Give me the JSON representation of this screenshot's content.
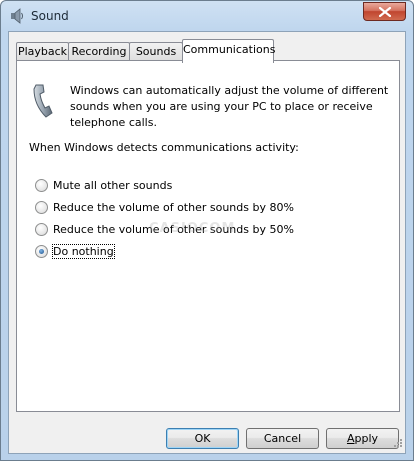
{
  "window": {
    "title": "Sound",
    "title_icon": "speaker-icon",
    "close_icon": "close-x-icon"
  },
  "tabs": [
    {
      "label": "Playback",
      "active": false
    },
    {
      "label": "Recording",
      "active": false
    },
    {
      "label": "Sounds",
      "active": false
    },
    {
      "label": "Communications",
      "active": true
    }
  ],
  "communications": {
    "icon": "telephone-handset-icon",
    "description": "Windows can automatically adjust the volume of different sounds when you are using your PC to place or receive telephone calls.",
    "detect_label": "When Windows detects communications activity:",
    "options": [
      {
        "label": "Mute all other sounds",
        "checked": false
      },
      {
        "label": "Reduce the volume of other sounds by 80%",
        "checked": false
      },
      {
        "label": "Reduce the volume of other sounds by 50%",
        "checked": false
      },
      {
        "label": "Do nothing",
        "checked": true
      }
    ]
  },
  "watermark": "CASIOCOM",
  "buttons": {
    "ok": "OK",
    "cancel": "Cancel",
    "apply_underlined": "A",
    "apply_rest": "pply"
  },
  "colors": {
    "titlebar": "#bfd6ee",
    "client_bg": "#f0f0f0",
    "close_button": "#c0452f",
    "default_button_border": "#3c7fb1"
  }
}
